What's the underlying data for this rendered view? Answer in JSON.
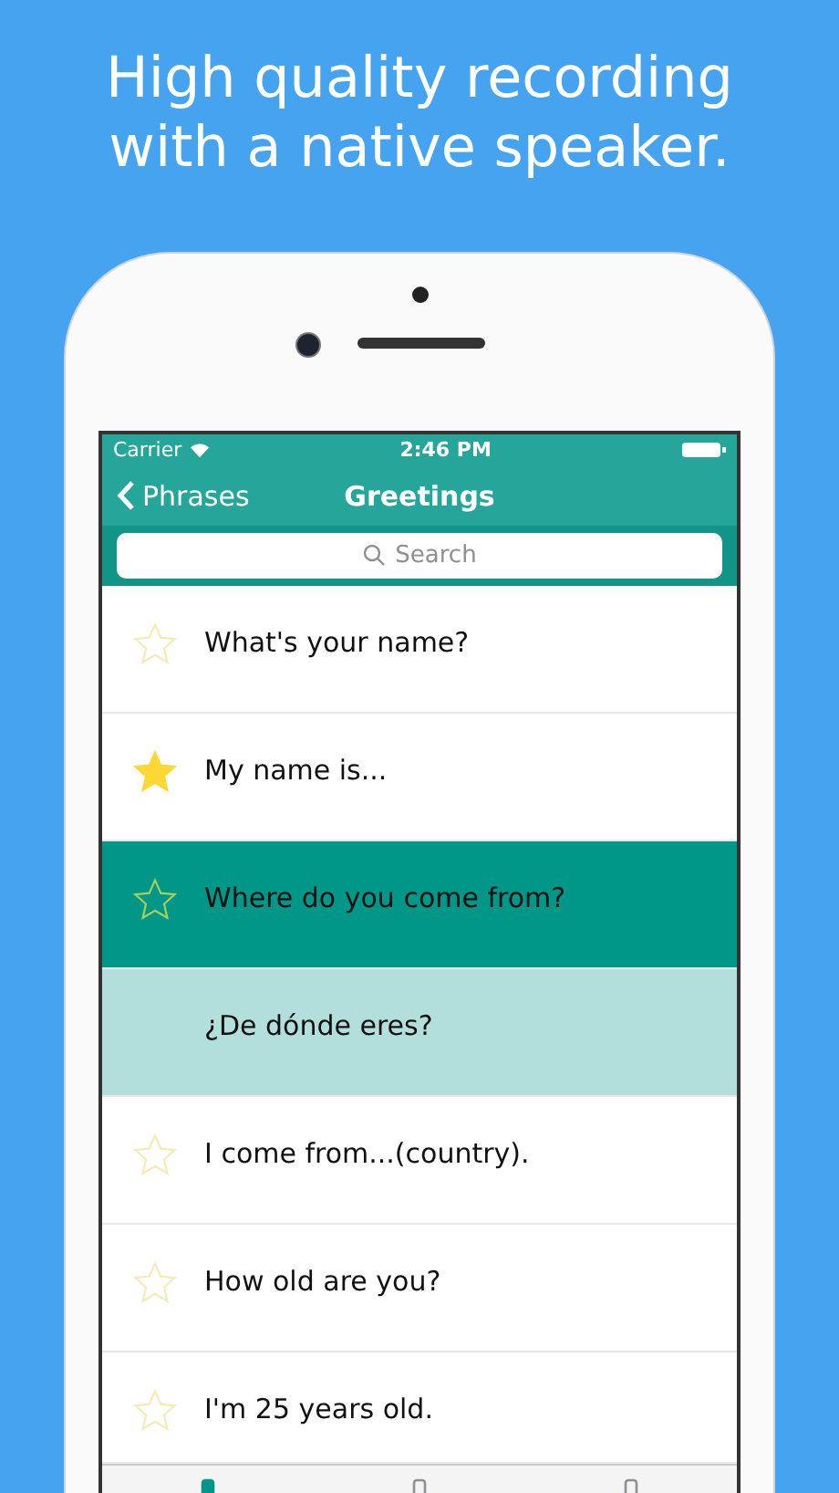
{
  "headline": "High quality recording with a native speaker.",
  "status_bar": {
    "carrier": "Carrier",
    "time": "2:46 PM"
  },
  "nav_bar": {
    "back": "Phrases",
    "title": "Greetings"
  },
  "search": {
    "placeholder": "Search"
  },
  "rows": [
    {
      "kind": "phrase",
      "text": "What's your name?",
      "starred": false,
      "selected": false
    },
    {
      "kind": "phrase",
      "text": "My name is...",
      "starred": true,
      "selected": false
    },
    {
      "kind": "phrase",
      "text": "Where do you come from?",
      "starred": false,
      "selected": true
    },
    {
      "kind": "translation",
      "text": "¿De dónde eres?"
    },
    {
      "kind": "phrase",
      "text": "I come from...(country).",
      "starred": false,
      "selected": false
    },
    {
      "kind": "phrase",
      "text": "How old are you?",
      "starred": false,
      "selected": false
    },
    {
      "kind": "phrase",
      "text": "I'm 25 years old.",
      "starred": false,
      "selected": false
    }
  ],
  "tab_bar": [
    {
      "selected": true
    },
    {
      "selected": false
    },
    {
      "selected": false
    }
  ]
}
